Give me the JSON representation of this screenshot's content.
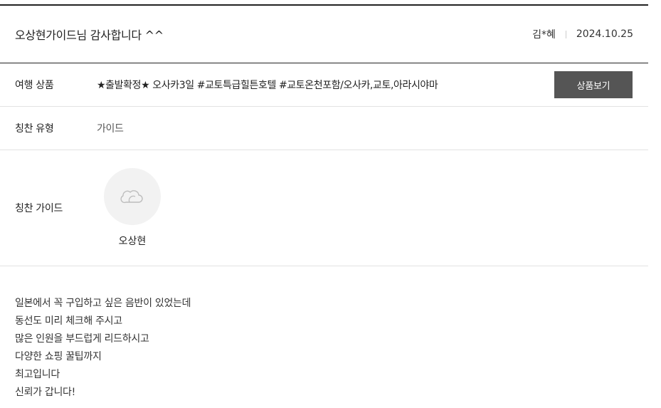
{
  "review": {
    "title": "오상현가이드님 감사합니다 ^^",
    "author": "김*혜",
    "date": "2024.10.25"
  },
  "product": {
    "label": "여행 상품",
    "name": "★출발확정★ 오사카3일 #교토특급힐튼호텔 #교토온천포함/오사카,교토,아라시야마",
    "button_label": "상품보기"
  },
  "praise_type": {
    "label": "칭찬 유형",
    "value": "가이드"
  },
  "praise_guide": {
    "label": "칭찬 가이드",
    "avatar_icon": "cloud-placeholder-icon",
    "name": "오상현"
  },
  "content": {
    "lines": [
      "일본에서 꼭 구입하고 싶은 음반이 있었는데",
      "동선도 미리 체크해 주시고",
      "많은 인원을 부드럽게 리드하시고",
      "다양한 쇼핑 꿀팁까지",
      "최고입니다",
      "신뢰가 갑니다!"
    ]
  }
}
